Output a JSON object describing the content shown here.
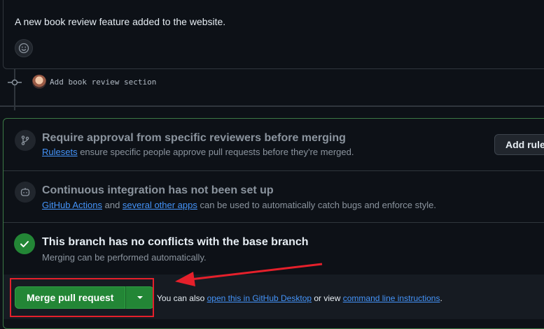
{
  "comment": {
    "text": "A new book review feature added to the website."
  },
  "commit": {
    "message": "Add book review section"
  },
  "checks": {
    "rulesets": {
      "title": "Require approval from specific reviewers before merging",
      "link": "Rulesets",
      "desc_rest": " ensure specific people approve pull requests before they're merged.",
      "button": "Add rule"
    },
    "ci": {
      "title": "Continuous integration has not been set up",
      "link1": "GitHub Actions",
      "and": " and ",
      "link2": "several other apps",
      "desc_rest": " can be used to automatically catch bugs and enforce style."
    },
    "conflicts": {
      "title": "This branch has no conflicts with the base branch",
      "desc": "Merging can be performed automatically."
    }
  },
  "footer": {
    "merge_label": "Merge pull request",
    "text_prefix": "You can also ",
    "link1": "open this in GitHub Desktop",
    "text_mid": " or view ",
    "link2": "command line instructions",
    "text_suffix": "."
  },
  "icons": {
    "emoji": "smiley-icon",
    "commit": "git-commit-icon",
    "branch": "git-branch-icon",
    "ci": "robot-icon",
    "check": "check-icon",
    "caret": "triangle-down-icon"
  },
  "colors": {
    "background": "#0d1117",
    "merge_green": "#238636",
    "link_blue": "#4493f8",
    "annotation_red": "#e5202b"
  }
}
